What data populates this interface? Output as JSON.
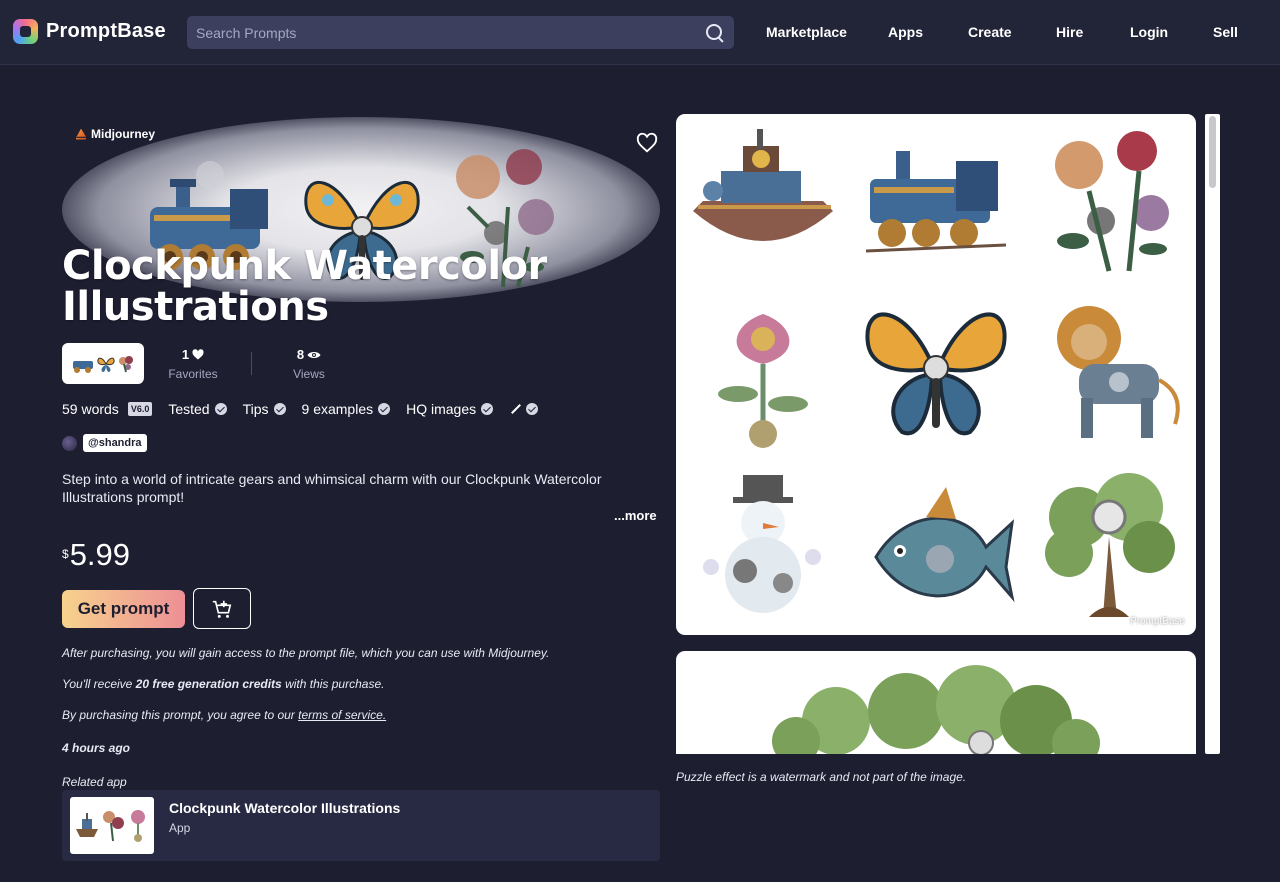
{
  "nav": {
    "brand": "PromptBase",
    "search_placeholder": "Search Prompts",
    "links": [
      "Marketplace",
      "Apps",
      "Create",
      "Hire",
      "Login",
      "Sell"
    ]
  },
  "prompt": {
    "model": "Midjourney",
    "title": "Clockpunk Watercolor Illustrations",
    "favorites_count": "1",
    "favorites_label": "Favorites",
    "views_count": "8",
    "views_label": "Views",
    "words": "59 words",
    "version": "V6.0",
    "tested": "Tested",
    "tips": "Tips",
    "examples": "9 examples",
    "hq": "HQ images",
    "author": "@shandra",
    "description": "Step into a world of intricate gears and whimsical charm with our Clockpunk Watercolor Illustrations prompt!",
    "more": "...more",
    "currency": "$",
    "price": "5.99",
    "get_button": "Get prompt"
  },
  "notes": {
    "after": "After purchasing, you will gain access to the prompt file, which you can use with Midjourney.",
    "credits_pre": "You'll receive ",
    "credits_bold": "20 free generation credits",
    "credits_post": " with this purchase.",
    "terms_pre": "By purchasing this prompt, you agree to our ",
    "terms_link": "terms of service.",
    "time": "4 hours ago",
    "related_label": "Related app"
  },
  "related_app": {
    "name": "Clockpunk Watercolor Illustrations",
    "type": "App"
  },
  "gallery": {
    "images": [
      "steampunk-airship",
      "steampunk-locomotive",
      "steampunk-roses",
      "steampunk-flower",
      "steampunk-butterfly",
      "steampunk-lion",
      "steampunk-snowman",
      "steampunk-fish",
      "steampunk-tree"
    ],
    "watermark": "PromptBase",
    "caption": "Puzzle effect is a watermark and not part of the image."
  }
}
